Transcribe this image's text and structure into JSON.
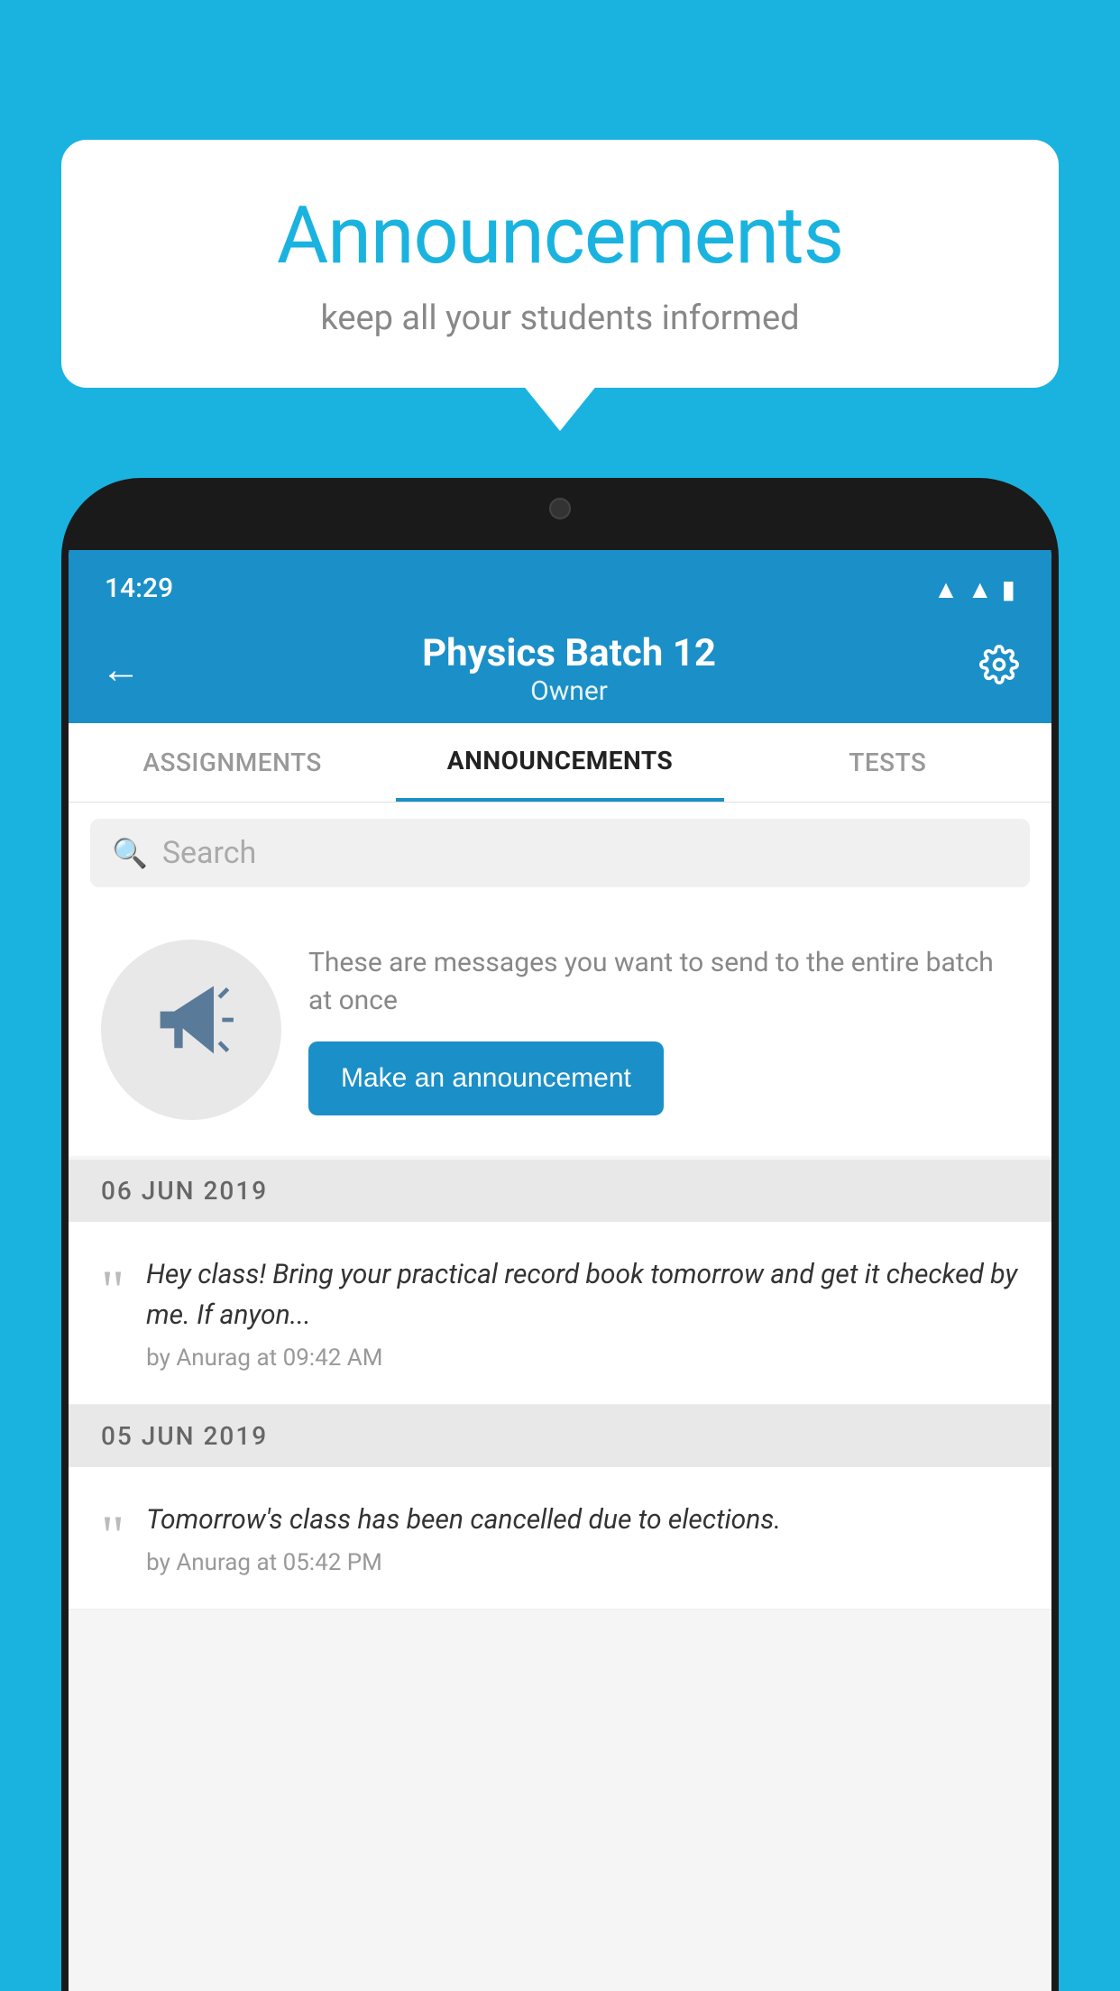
{
  "page": {
    "background_color": "#1ab3e0"
  },
  "speech_bubble": {
    "title": "Announcements",
    "subtitle": "keep all your students informed"
  },
  "status_bar": {
    "time": "14:29"
  },
  "app_header": {
    "batch_name": "Physics Batch 12",
    "owner_label": "Owner",
    "back_label": "←",
    "gear_label": "⚙"
  },
  "tabs": [
    {
      "label": "ASSIGNMENTS",
      "active": false
    },
    {
      "label": "ANNOUNCEMENTS",
      "active": true
    },
    {
      "label": "TESTS",
      "active": false
    }
  ],
  "search": {
    "placeholder": "Search"
  },
  "announcement_promo": {
    "description": "These are messages you want to send to the entire batch at once",
    "button_label": "Make an announcement"
  },
  "announcements": [
    {
      "date": "06  JUN  2019",
      "message": "Hey class! Bring your practical record book tomorrow and get it checked by me. If anyon...",
      "meta": "by Anurag at 09:42 AM"
    },
    {
      "date": "05  JUN  2019",
      "message": "Tomorrow's class has been cancelled due to elections.",
      "meta": "by Anurag at 05:42 PM"
    }
  ]
}
